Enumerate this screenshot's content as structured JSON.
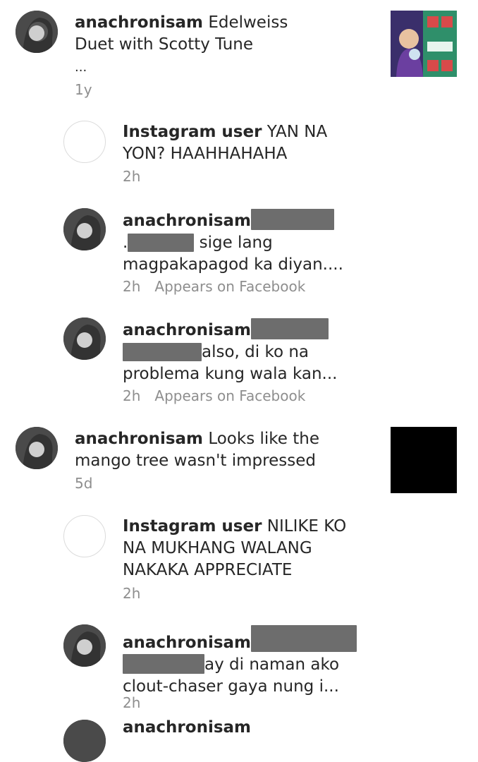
{
  "comments": [
    {
      "user": "anachronisam",
      "text": "Edelweiss",
      "line2": "Duet with Scotty Tune",
      "line3": "...",
      "time": "1y"
    },
    {
      "user": "Instagram user",
      "text": "YAN NA",
      "line2": "YON? HAAHHAHAHA",
      "time": "2h"
    },
    {
      "user": "anachronisam",
      "line2": "sige lang",
      "line2_prefix": ".",
      "line3": "magpakapagod ka diyan....",
      "time": "2h",
      "source": "Appears on Facebook"
    },
    {
      "user": "anachronisam",
      "line2": "also, di ko na",
      "line3": "problema kung wala kan...",
      "time": "2h",
      "source": "Appears on Facebook"
    },
    {
      "user": "anachronisam",
      "text": "Looks like the",
      "line2": "mango tree wasn't impressed",
      "time": "5d"
    },
    {
      "user": "Instagram user",
      "text": "NILIKE KO",
      "line2": "NA MUKHANG WALANG",
      "line3": "NAKAKA APPRECIATE",
      "time": "2h"
    },
    {
      "user": "anachronisam",
      "line2": "ay di naman ako",
      "line3": "clout-chaser gaya nung i...",
      "time": "2h"
    },
    {
      "user": "anachronisam"
    }
  ]
}
